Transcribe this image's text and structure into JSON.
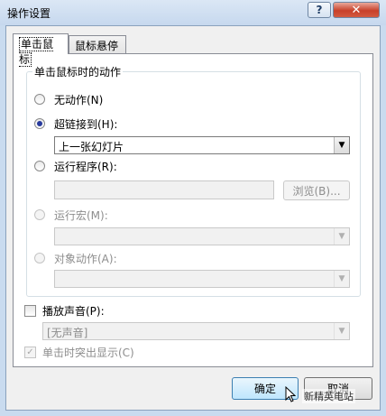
{
  "window": {
    "title": "操作设置",
    "help_label": "?",
    "close_label": "✕"
  },
  "tabs": [
    {
      "label": "单击鼠标",
      "active": true
    },
    {
      "label": "鼠标悬停",
      "active": false
    }
  ],
  "group": {
    "title": "单击鼠标时的动作",
    "options": {
      "none": {
        "label": "无动作(N)",
        "selected": false,
        "enabled": true
      },
      "hyperlink": {
        "label": "超链接到(H):",
        "selected": true,
        "enabled": true,
        "value": "上一张幻灯片"
      },
      "run_program": {
        "label": "运行程序(R):",
        "selected": false,
        "enabled": true,
        "value": "",
        "browse_label": "浏览(B)..."
      },
      "run_macro": {
        "label": "运行宏(M):",
        "selected": false,
        "enabled": false,
        "value": ""
      },
      "object_action": {
        "label": "对象动作(A):",
        "selected": false,
        "enabled": false,
        "value": ""
      }
    }
  },
  "sound": {
    "label": "播放声音(P):",
    "checked": false,
    "value": "[无声音]"
  },
  "highlight": {
    "label": "单击时突出显示(C)",
    "checked": true,
    "enabled": false
  },
  "buttons": {
    "ok": "确定",
    "cancel": "取消"
  },
  "watermark": "新精英电站"
}
